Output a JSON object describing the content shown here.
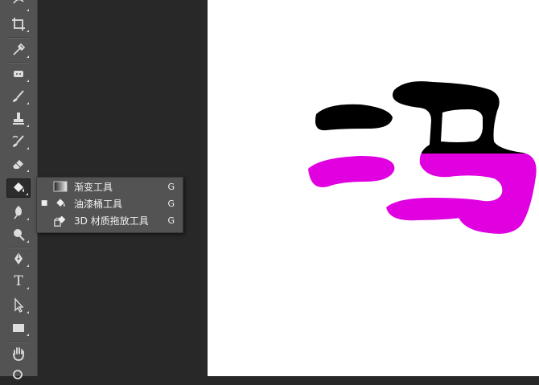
{
  "toolbar": {
    "tools": [
      {
        "name": "lasso-tool",
        "icon": "lasso-icon"
      },
      {
        "name": "crop-tool",
        "icon": "crop-icon"
      },
      {
        "name": "eyedropper-tool",
        "icon": "eyedropper-icon"
      },
      {
        "name": "spot-healing-tool",
        "icon": "bandage-icon"
      },
      {
        "name": "brush-tool",
        "icon": "brush-icon"
      },
      {
        "name": "clone-stamp-tool",
        "icon": "stamp-icon"
      },
      {
        "name": "history-brush-tool",
        "icon": "history-brush-icon"
      },
      {
        "name": "eraser-tool",
        "icon": "eraser-icon"
      },
      {
        "name": "paint-bucket-tool",
        "icon": "paint-bucket-icon"
      },
      {
        "name": "blur-tool",
        "icon": "blur-icon"
      },
      {
        "name": "dodge-tool",
        "icon": "dodge-icon"
      },
      {
        "name": "pen-tool",
        "icon": "pen-icon"
      },
      {
        "name": "type-tool",
        "icon": "type-icon",
        "glyph": "T"
      },
      {
        "name": "path-selection-tool",
        "icon": "arrow-icon"
      },
      {
        "name": "rectangle-tool",
        "icon": "rectangle-icon"
      },
      {
        "name": "hand-tool",
        "icon": "hand-icon"
      }
    ]
  },
  "flyout": {
    "items": [
      {
        "label": "渐变工具",
        "shortcut": "G",
        "selected": false,
        "icon": "gradient-icon"
      },
      {
        "label": "油漆桶工具",
        "shortcut": "G",
        "selected": true,
        "bullet": "■",
        "icon": "paint-bucket-icon"
      },
      {
        "label": "3D 材质拖放工具",
        "shortcut": "G",
        "selected": false,
        "icon": "3d-material-drop-icon"
      }
    ]
  },
  "canvas": {
    "glyph": "冯",
    "colors": {
      "top": "#000000",
      "bottom": "#e000e0",
      "background": "#ffffff"
    }
  }
}
